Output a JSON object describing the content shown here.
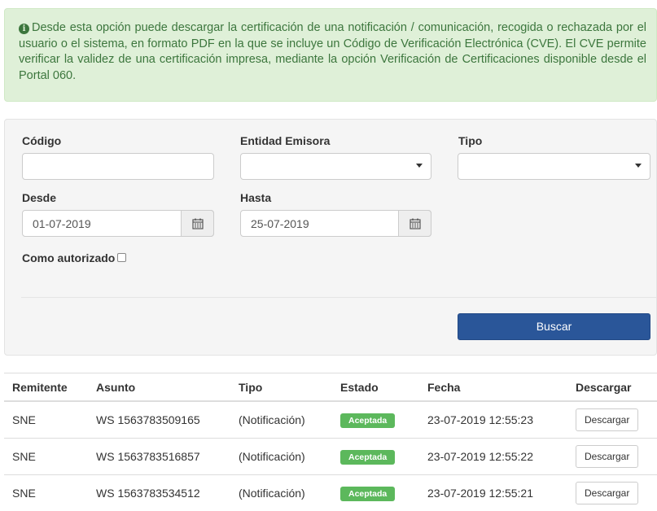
{
  "alert": {
    "text": "Desde esta opción puede descargar la certificación de una notificación / comunicación, recogida o rechazada por el usuario o el sistema, en formato PDF en la que se incluye un Código de Verificación Electrónica (CVE). El CVE permite verificar la validez de una certificación impresa, mediante la opción Verificación de Certificaciones disponible desde el Portal 060.",
    "icon": "info-circle-icon"
  },
  "form": {
    "codigo_label": "Código",
    "codigo_value": "",
    "entidad_label": "Entidad Emisora",
    "entidad_value": "",
    "tipo_label": "Tipo",
    "tipo_value": "",
    "desde_label": "Desde",
    "desde_value": "01-07-2019",
    "hasta_label": "Hasta",
    "hasta_value": "25-07-2019",
    "autorizado_label": "Como autorizado",
    "search_button": "Buscar"
  },
  "table": {
    "headers": [
      "Remitente",
      "Asunto",
      "Tipo",
      "Estado",
      "Fecha",
      "Descargar"
    ],
    "rows": [
      {
        "remitente": "SNE",
        "asunto": "WS 1563783509165",
        "tipo": "(Notificación)",
        "estado": "Aceptada",
        "fecha": "23-07-2019 12:55:23",
        "accion": "Descargar"
      },
      {
        "remitente": "SNE",
        "asunto": "WS 1563783516857",
        "tipo": "(Notificación)",
        "estado": "Aceptada",
        "fecha": "23-07-2019 12:55:22",
        "accion": "Descargar"
      },
      {
        "remitente": "SNE",
        "asunto": "WS 1563783534512",
        "tipo": "(Notificación)",
        "estado": "Aceptada",
        "fecha": "23-07-2019 12:55:21",
        "accion": "Descargar"
      }
    ]
  },
  "colors": {
    "alert_bg": "#dff0d8",
    "alert_text": "#3c763d",
    "primary": "#2a5699",
    "badge_success": "#5cb85c"
  }
}
